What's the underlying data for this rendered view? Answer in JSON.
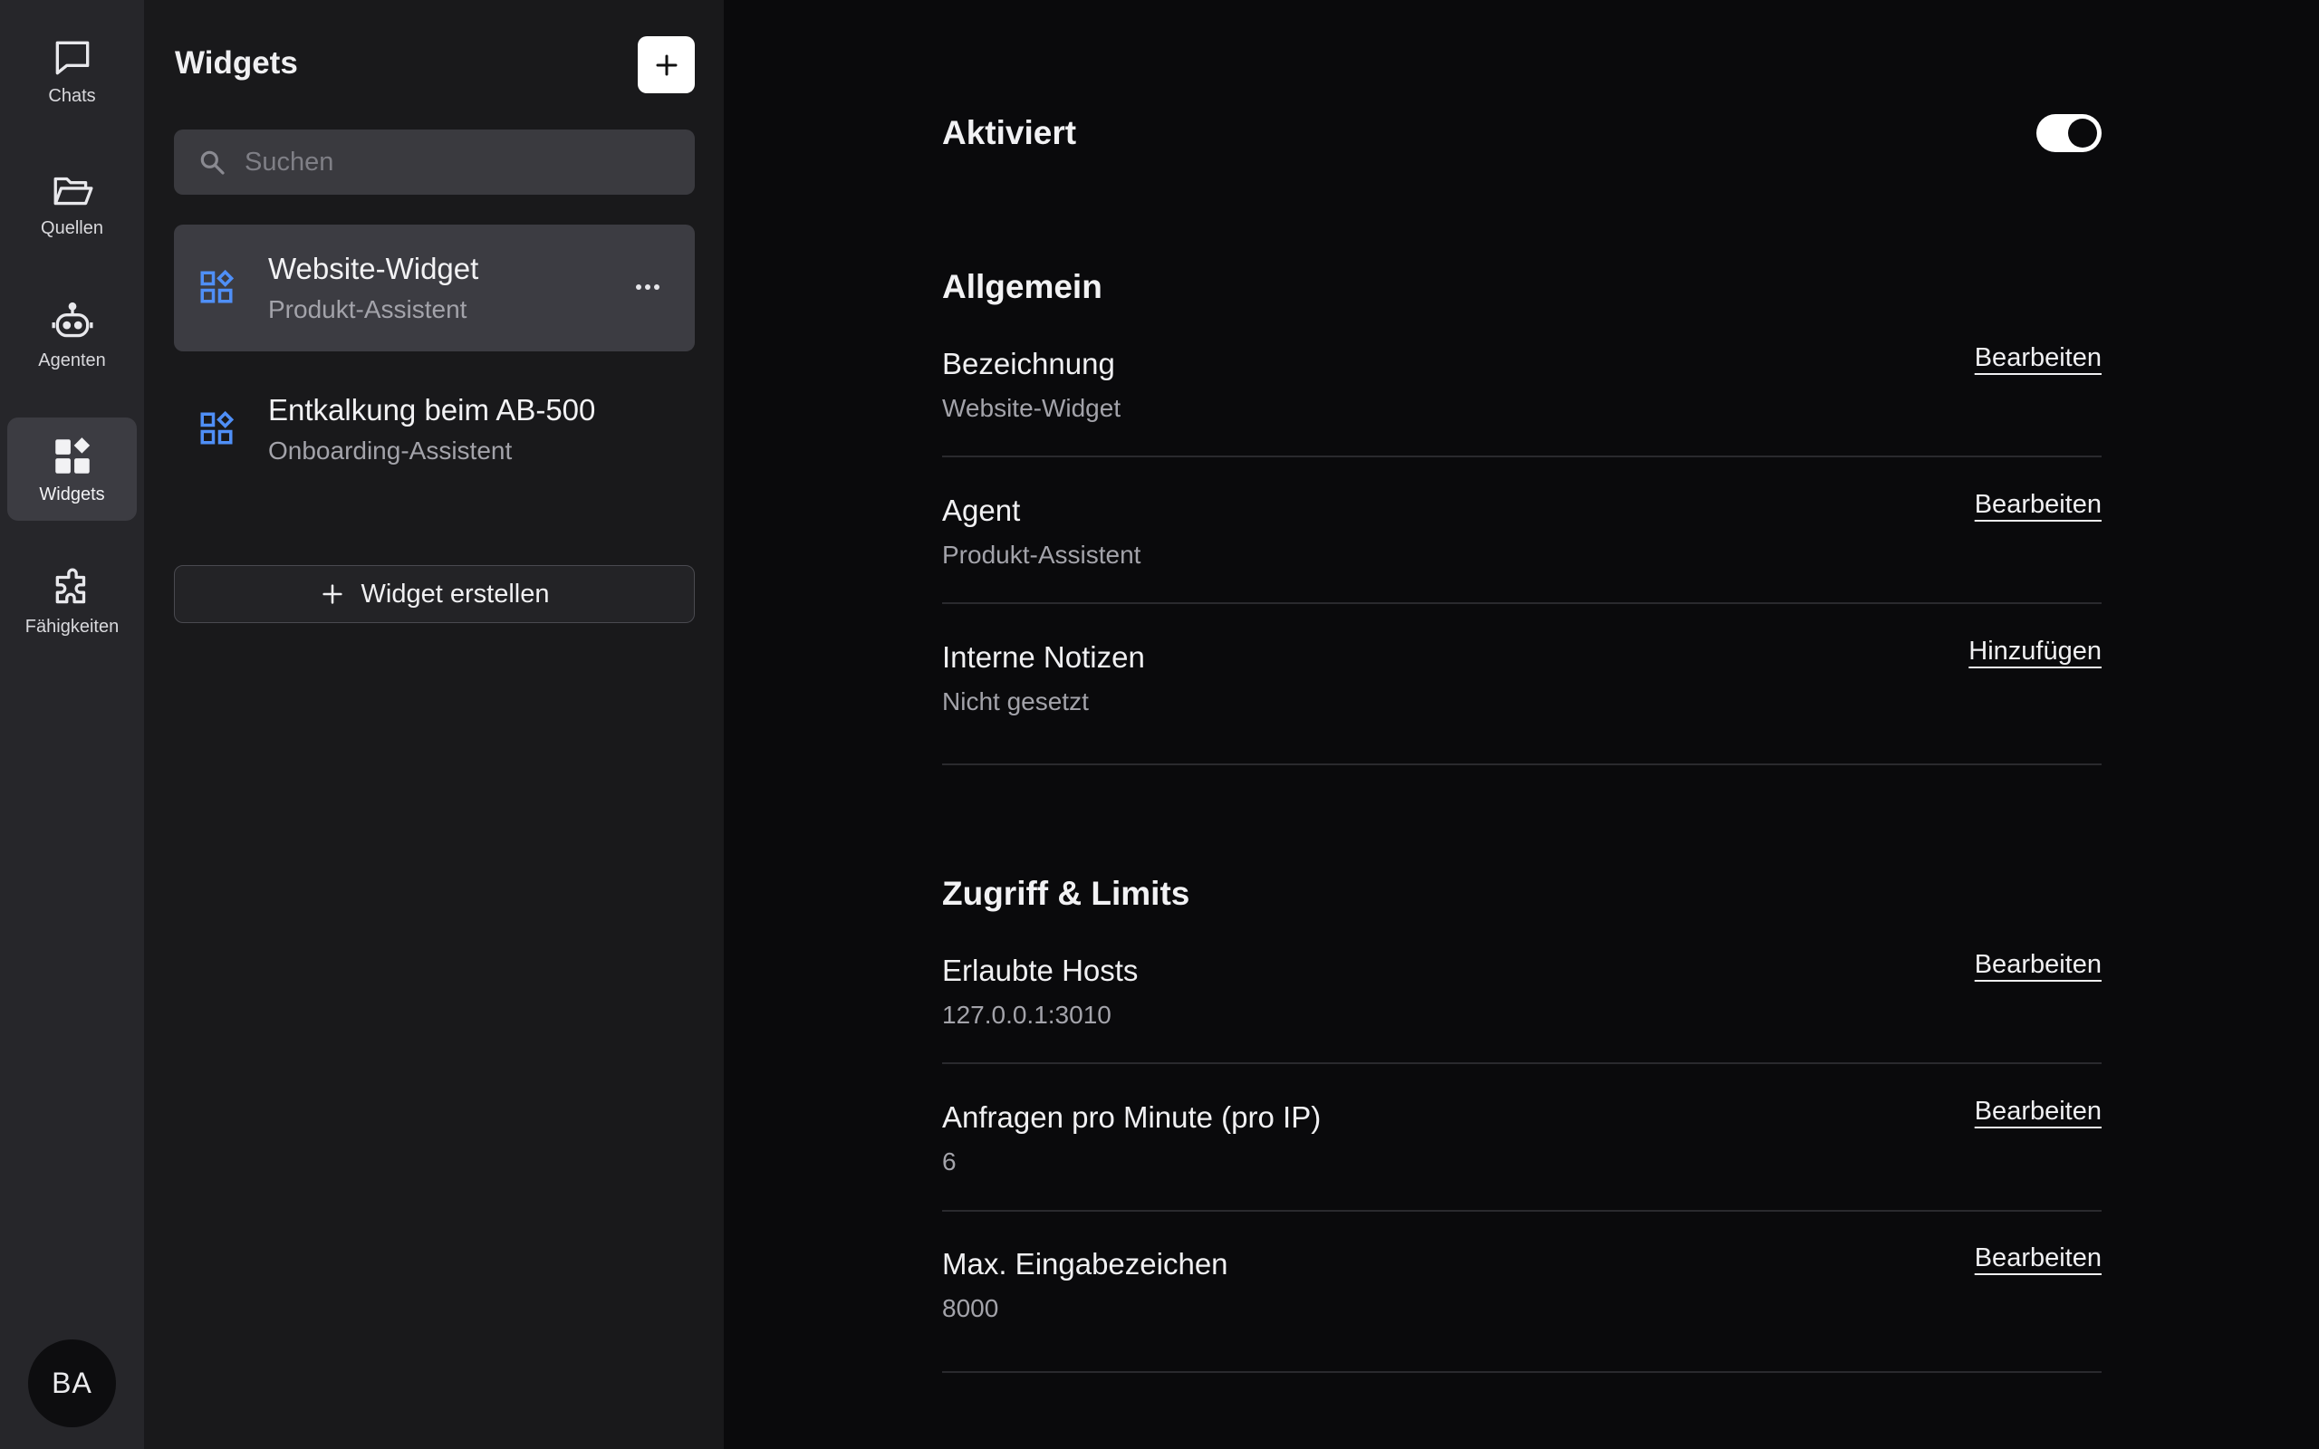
{
  "rail": {
    "items": [
      {
        "label": "Chats",
        "icon": "chat-bubble-icon"
      },
      {
        "label": "Quellen",
        "icon": "folder-open-icon"
      },
      {
        "label": "Agenten",
        "icon": "robot-icon"
      },
      {
        "label": "Widgets",
        "icon": "widgets-icon",
        "active": true
      },
      {
        "label": "Fähigkeiten",
        "icon": "puzzle-icon"
      }
    ],
    "avatar_initials": "BA"
  },
  "panel": {
    "title": "Widgets",
    "search_placeholder": "Suchen",
    "items": [
      {
        "title": "Website-Widget",
        "subtitle": "Produkt-Assistent",
        "selected": true
      },
      {
        "title": "Entkalkung beim AB-500",
        "subtitle": "Onboarding-Assistent",
        "selected": false
      }
    ],
    "create_label": "Widget erstellen"
  },
  "main": {
    "enabled_label": "Aktiviert",
    "enabled": true,
    "general": {
      "heading": "Allgemein",
      "rows": [
        {
          "label": "Bezeichnung",
          "value": "Website-Widget",
          "action": "Bearbeiten"
        },
        {
          "label": "Agent",
          "value": "Produkt-Assistent",
          "action": "Bearbeiten"
        },
        {
          "label": "Interne Notizen",
          "value": "Nicht gesetzt",
          "action": "Hinzufügen"
        }
      ]
    },
    "access": {
      "heading": "Zugriff & Limits",
      "rows": [
        {
          "label": "Erlaubte Hosts",
          "value": "127.0.0.1:3010",
          "action": "Bearbeiten"
        },
        {
          "label": "Anfragen pro Minute (pro IP)",
          "value": "6",
          "action": "Bearbeiten"
        },
        {
          "label": "Max. Eingabezeichen",
          "value": "8000",
          "action": "Bearbeiten"
        }
      ]
    }
  },
  "colors": {
    "accent_icon": "#4f8ff7",
    "rail_bg": "#26262a",
    "panel_bg": "#19191b",
    "main_bg": "#0a0a0c"
  }
}
